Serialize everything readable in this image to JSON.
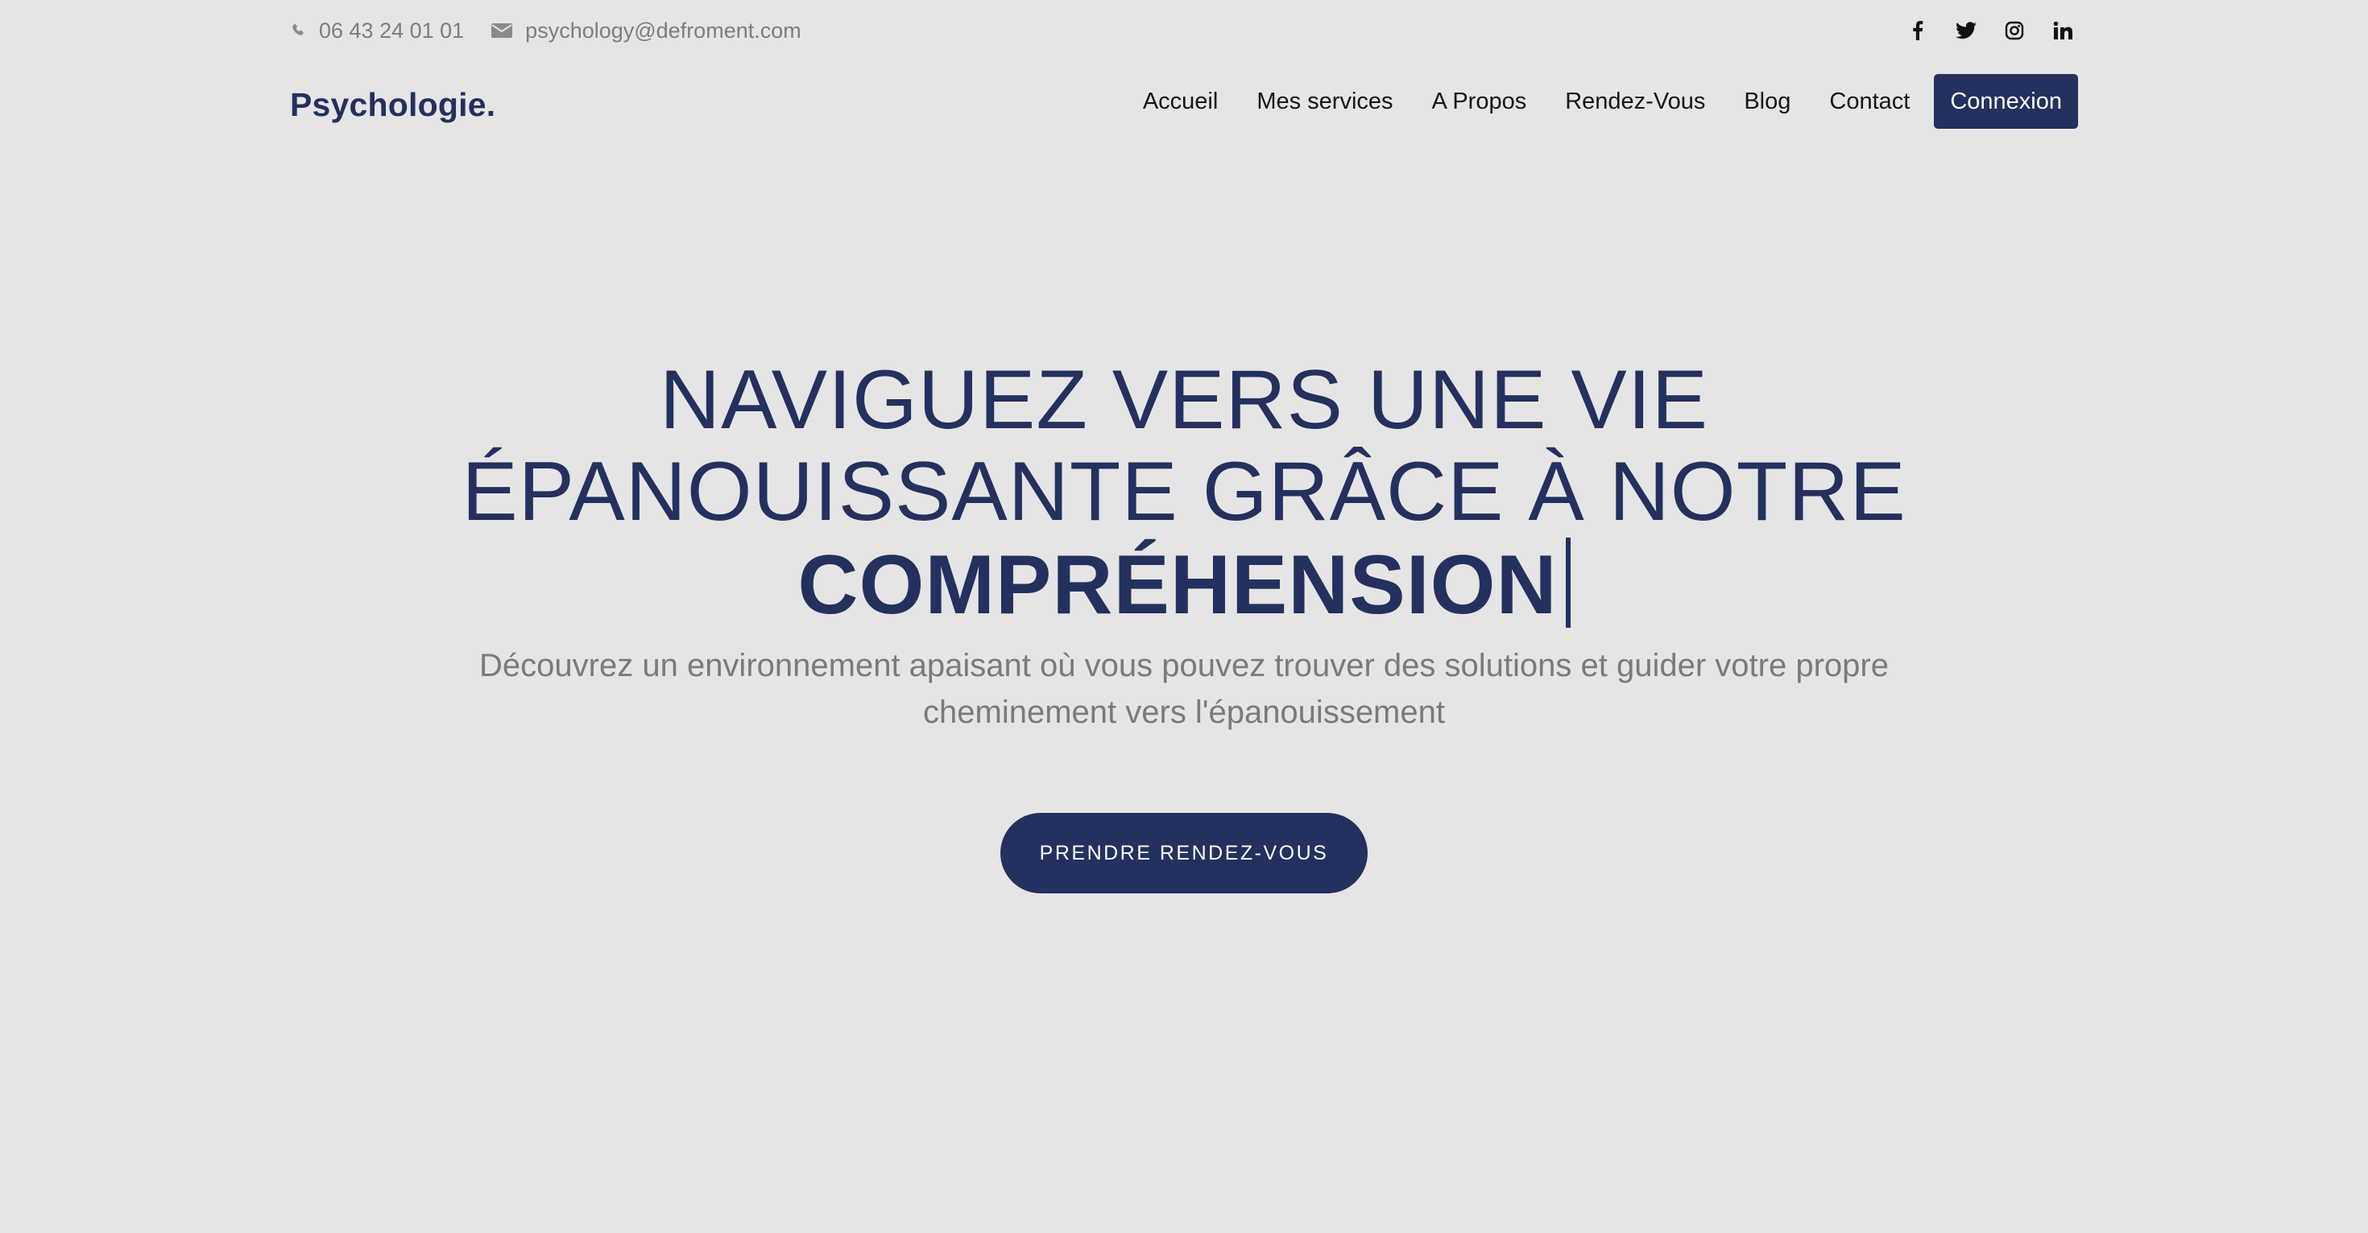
{
  "topbar": {
    "phone": "06 43 24 01 01",
    "email": "psychology@defroment.com",
    "social": [
      {
        "icon": "facebook-icon"
      },
      {
        "icon": "twitter-icon"
      },
      {
        "icon": "instagram-icon"
      },
      {
        "icon": "linkedin-icon"
      }
    ]
  },
  "navbar": {
    "logo": "Psychologie.",
    "items": [
      "Accueil",
      "Mes services",
      "A Propos",
      "Rendez-Vous",
      "Blog",
      "Contact"
    ],
    "cta": "Connexion"
  },
  "hero": {
    "title_line1": "NAVIGUEZ VERS UNE VIE",
    "title_line2": "ÉPANOUISSANTE GRÂCE À NOTRE",
    "title_strong": "COMPRÉHENSION",
    "subtitle": "Découvrez un environnement apaisant où vous pouvez trouver des solutions et guider votre propre cheminement vers l'épanouissement",
    "cta": "PRENDRE RENDEZ-VOUS"
  },
  "colors": {
    "background": "#e5e5e5",
    "brand": "#24305e",
    "muted_text": "#7a7a7a"
  }
}
